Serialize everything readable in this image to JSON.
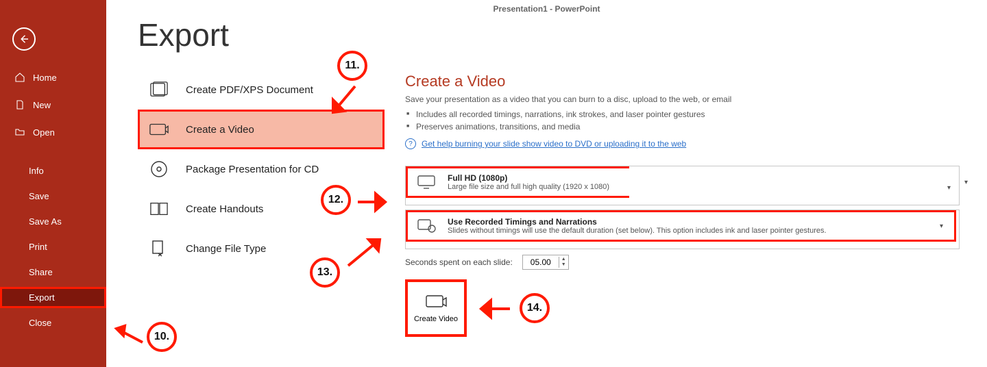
{
  "window": {
    "title": "Presentation1 - PowerPoint"
  },
  "sidebar": {
    "items": [
      {
        "label": "Home"
      },
      {
        "label": "New"
      },
      {
        "label": "Open"
      },
      {
        "label": "Info"
      },
      {
        "label": "Save"
      },
      {
        "label": "Save As"
      },
      {
        "label": "Print"
      },
      {
        "label": "Share"
      },
      {
        "label": "Export"
      },
      {
        "label": "Close"
      }
    ]
  },
  "page": {
    "title": "Export"
  },
  "export_options": [
    {
      "label": "Create PDF/XPS Document"
    },
    {
      "label": "Create a Video"
    },
    {
      "label": "Package Presentation for CD"
    },
    {
      "label": "Create Handouts"
    },
    {
      "label": "Change File Type"
    }
  ],
  "video": {
    "heading": "Create a Video",
    "sub": "Save your presentation as a video that you can burn to a disc, upload to the web, or email",
    "bullets": [
      "Includes all recorded timings, narrations, ink strokes, and laser pointer gestures",
      "Preserves animations, transitions, and media"
    ],
    "help_link": "Get help burning your slide show video to DVD or uploading it to the web",
    "quality": {
      "title": "Full HD (1080p)",
      "desc": "Large file size and full high quality (1920 x 1080)"
    },
    "timings": {
      "title": "Use Recorded Timings and Narrations",
      "desc": "Slides without timings will use the default duration (set below). This option includes ink and laser pointer gestures."
    },
    "seconds_label": "Seconds spent on each slide:",
    "seconds_value": "05.00",
    "create_label": "Create Video"
  },
  "annotations": {
    "n10": "10.",
    "n11": "11.",
    "n12": "12.",
    "n13": "13.",
    "n14": "14."
  }
}
